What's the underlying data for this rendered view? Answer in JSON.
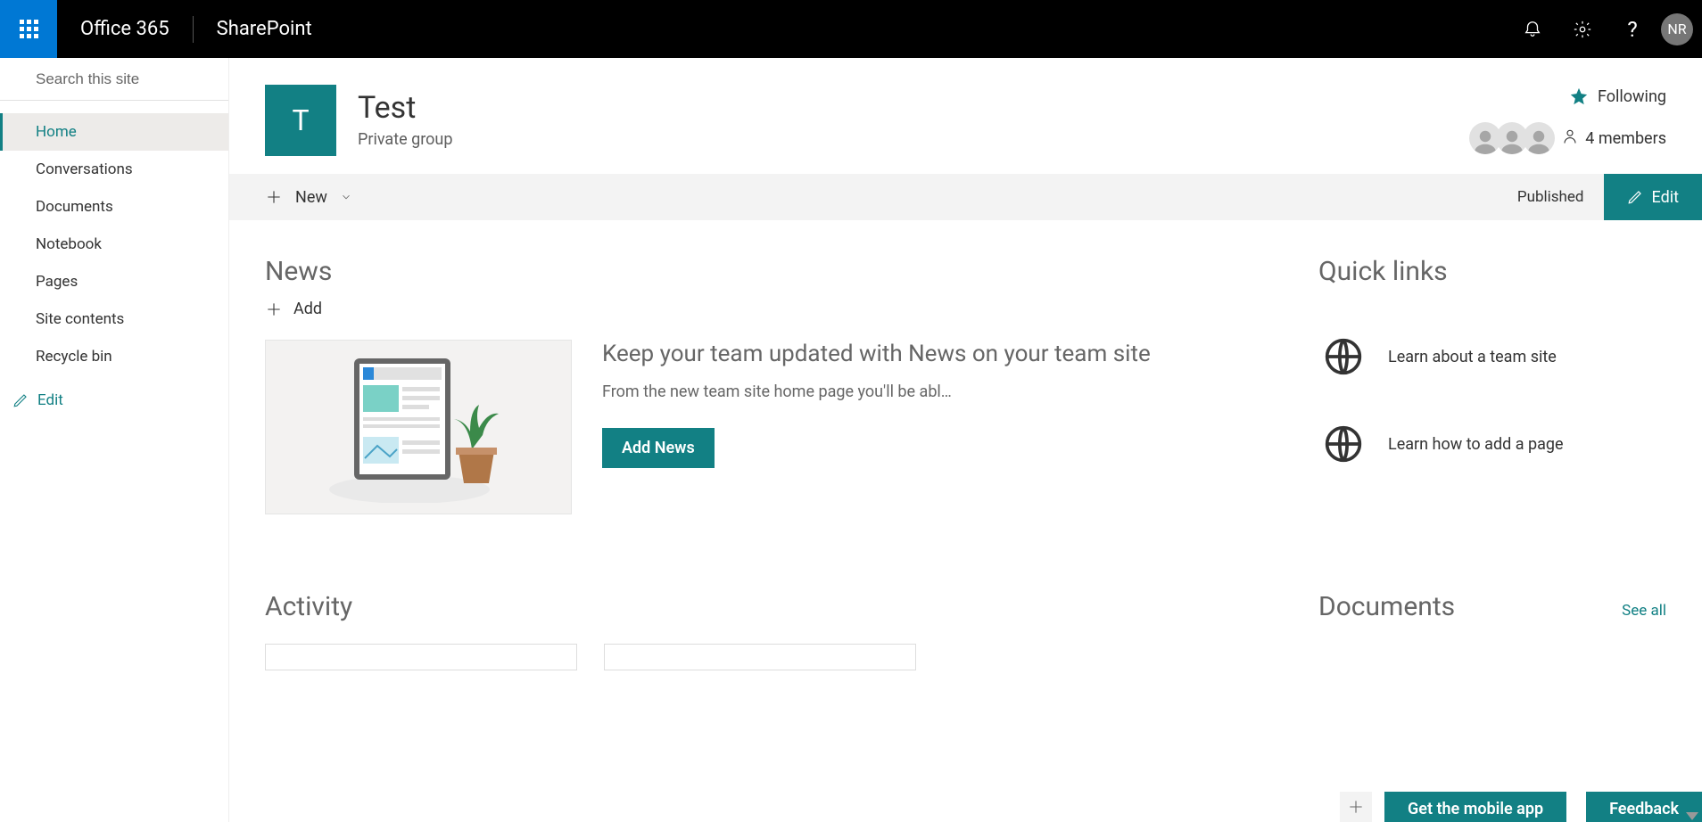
{
  "appbar": {
    "brand": "Office 365",
    "app": "SharePoint",
    "help_glyph": "?",
    "avatar_initials": "NR"
  },
  "search": {
    "placeholder": "Search this site"
  },
  "nav": {
    "items": [
      {
        "label": "Home",
        "active": true
      },
      {
        "label": "Conversations"
      },
      {
        "label": "Documents"
      },
      {
        "label": "Notebook"
      },
      {
        "label": "Pages"
      },
      {
        "label": "Site contents"
      },
      {
        "label": "Recycle bin"
      }
    ],
    "edit_label": "Edit"
  },
  "site": {
    "logo_letter": "T",
    "title": "Test",
    "subtitle": "Private group",
    "following_label": "Following",
    "members_label": "4 members"
  },
  "command": {
    "new_label": "New",
    "published_label": "Published",
    "edit_label": "Edit"
  },
  "news": {
    "section_title": "News",
    "add_label": "Add",
    "headline": "Keep your team updated with News on your team site",
    "description": "From the new team site home page you'll be abl…",
    "button_label": "Add News"
  },
  "quicklinks": {
    "section_title": "Quick links",
    "items": [
      {
        "label": "Learn about a team site"
      },
      {
        "label": "Learn how to add a page"
      }
    ]
  },
  "activity": {
    "section_title": "Activity"
  },
  "documents": {
    "section_title": "Documents",
    "see_all_label": "See all"
  },
  "float": {
    "mobile_label": "Get the mobile app",
    "feedback_label": "Feedback"
  }
}
